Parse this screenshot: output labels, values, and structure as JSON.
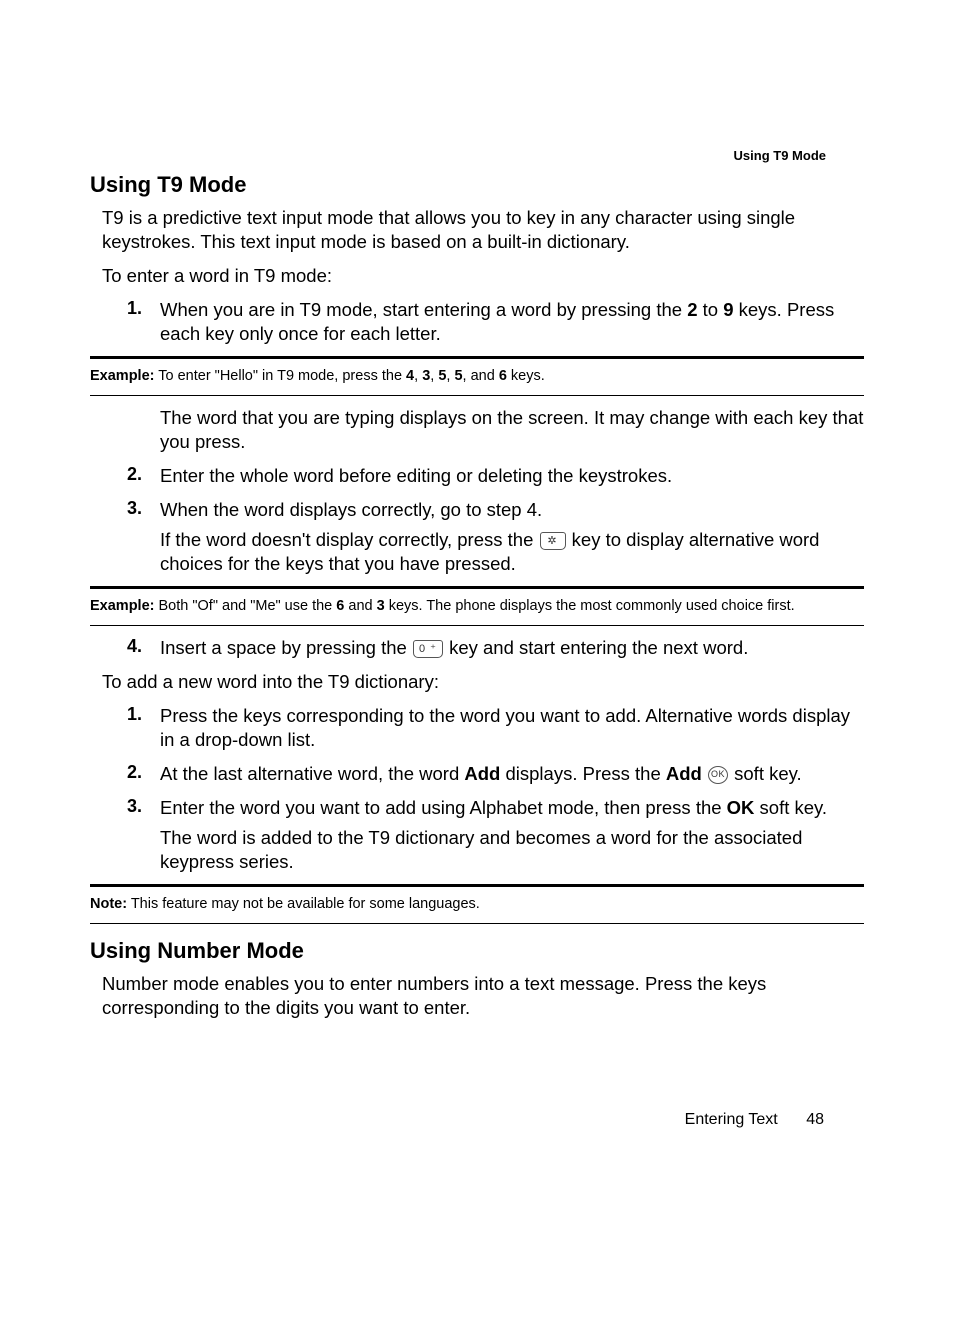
{
  "running_head": "Using T9 Mode",
  "sections": {
    "t9": {
      "title": "Using T9 Mode",
      "intro1": "T9 is a predictive text input mode that allows you to key in any character using single keystrokes. This text input mode is based on a built-in dictionary.",
      "intro2": "To enter a word in T9 mode:",
      "list1": {
        "1": {
          "n": "1.",
          "pre": "When you are in T9 mode, start entering a word by pressing the ",
          "k2": "2",
          "mid": " to ",
          "k9": "9",
          "post": " keys. Press each key only once for each letter."
        }
      },
      "example1": {
        "label": "Example:",
        "pre": " To enter \"Hello\" in T9 mode, press the ",
        "k4": "4",
        "c1": ", ",
        "k3": "3",
        "c2": ", ",
        "k5a": "5",
        "c3": ", ",
        "k5b": "5",
        "c4": ", and ",
        "k6": "6",
        "post": " keys."
      },
      "after_ex1": "The word that you are typing displays on the screen. It may change with each key that you press.",
      "list2": {
        "2": {
          "n": "2.",
          "t": "Enter the whole word before editing or deleting the keystrokes."
        },
        "3": {
          "n": "3.",
          "t": "When the word displays correctly, go to step 4.",
          "cont_pre": "If the word doesn't display correctly, press the ",
          "key_star": "*",
          "cont_post": " key to display alternative word choices for the keys that you have pressed."
        }
      },
      "example2": {
        "label": "Example:",
        "pre": " Both \"Of\" and \"Me\" use the ",
        "k6": "6",
        "mid1": " and ",
        "k3": "3",
        "post": " keys. The phone displays the most commonly used choice first."
      },
      "list3": {
        "4": {
          "n": "4.",
          "pre": "Insert a space by pressing the ",
          "key0": "0 ",
          "post": " key and start entering the next word."
        }
      },
      "add_intro": "To add a new word into the T9 dictionary:",
      "add_list": {
        "1": {
          "n": "1.",
          "t": "Press the keys corresponding to the word you want to add. Alternative words display in a drop-down list."
        },
        "2": {
          "n": "2.",
          "pre": "At the last alternative word, the word ",
          "b1": "Add",
          "mid": " displays. Press the ",
          "b2": "Add",
          "ok": "OK",
          "post": " soft key."
        },
        "3": {
          "n": "3.",
          "pre": "Enter the word you want to add using Alphabet mode, then press the ",
          "b1": "OK",
          "post": " soft key.",
          "cont": "The word is added to the T9 dictionary and becomes a word for the associated keypress series."
        }
      },
      "note": {
        "label": "Note:",
        "text": " This feature may not be available for some languages."
      }
    },
    "number": {
      "title": "Using Number Mode",
      "body": "Number mode enables you to enter numbers into a text message. Press the keys corresponding to the digits you want to enter."
    }
  },
  "footer": {
    "section": "Entering Text",
    "page": "48"
  }
}
